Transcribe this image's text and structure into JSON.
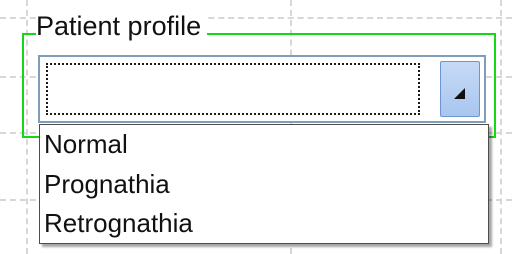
{
  "group": {
    "label": "Patient profile"
  },
  "combobox": {
    "value": "",
    "options": [
      "Normal",
      "Prognathia",
      "Retrognathia"
    ]
  },
  "icons": {
    "dropdown_button": "dropdown-arrow-icon"
  },
  "colors": {
    "selection_border": "#14d814",
    "combo_border": "#7f9db9",
    "button_fill": "#b9d1f3"
  }
}
